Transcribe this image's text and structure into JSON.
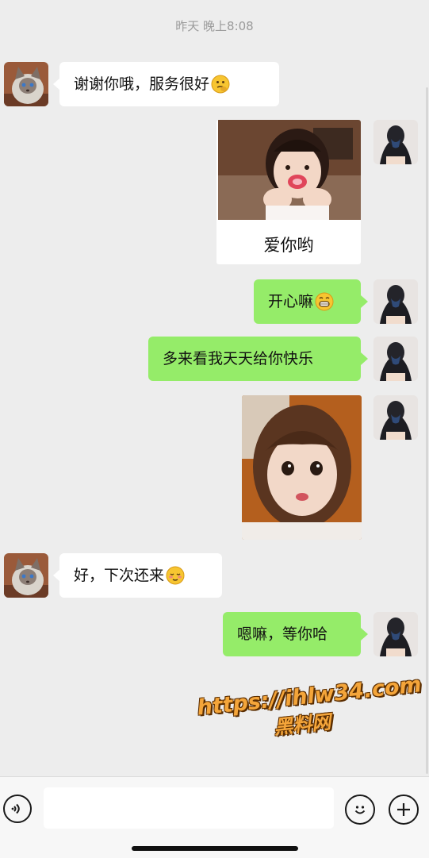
{
  "header": {
    "timestamp": "昨天 晚上8:08"
  },
  "messages": [
    {
      "side": "in",
      "type": "text",
      "text": "谢谢你哦，服务很好",
      "emoji": "thinking-face-emoji"
    },
    {
      "side": "out",
      "type": "sticker",
      "caption": "爱你哟",
      "image": "toddler-blowing-kiss-sticker"
    },
    {
      "side": "out",
      "type": "text",
      "text": "开心嘛",
      "emoji": "grinning-face-emoji"
    },
    {
      "side": "out",
      "type": "text",
      "text": "多来看我天天给你快乐"
    },
    {
      "side": "out",
      "type": "image",
      "image": "toddler-portrait-photo"
    },
    {
      "side": "in",
      "type": "text",
      "text": "好，下次还来",
      "emoji": "blushing-face-emoji"
    },
    {
      "side": "out",
      "type": "text",
      "text": "嗯嘛，等你哈"
    }
  ],
  "avatars": {
    "contact": "cat-avatar",
    "self": "woman-avatar"
  },
  "watermark": {
    "line1": "https://ihlw34.com",
    "line2": "黑料网"
  },
  "input_bar": {
    "voice_icon": "voice-icon",
    "emoji_icon": "emoji-icon",
    "plus_icon": "plus-icon"
  },
  "colors": {
    "background": "#ededed",
    "outgoing_bubble": "#95ec69",
    "incoming_bubble": "#ffffff",
    "watermark": "#f4a53a"
  }
}
